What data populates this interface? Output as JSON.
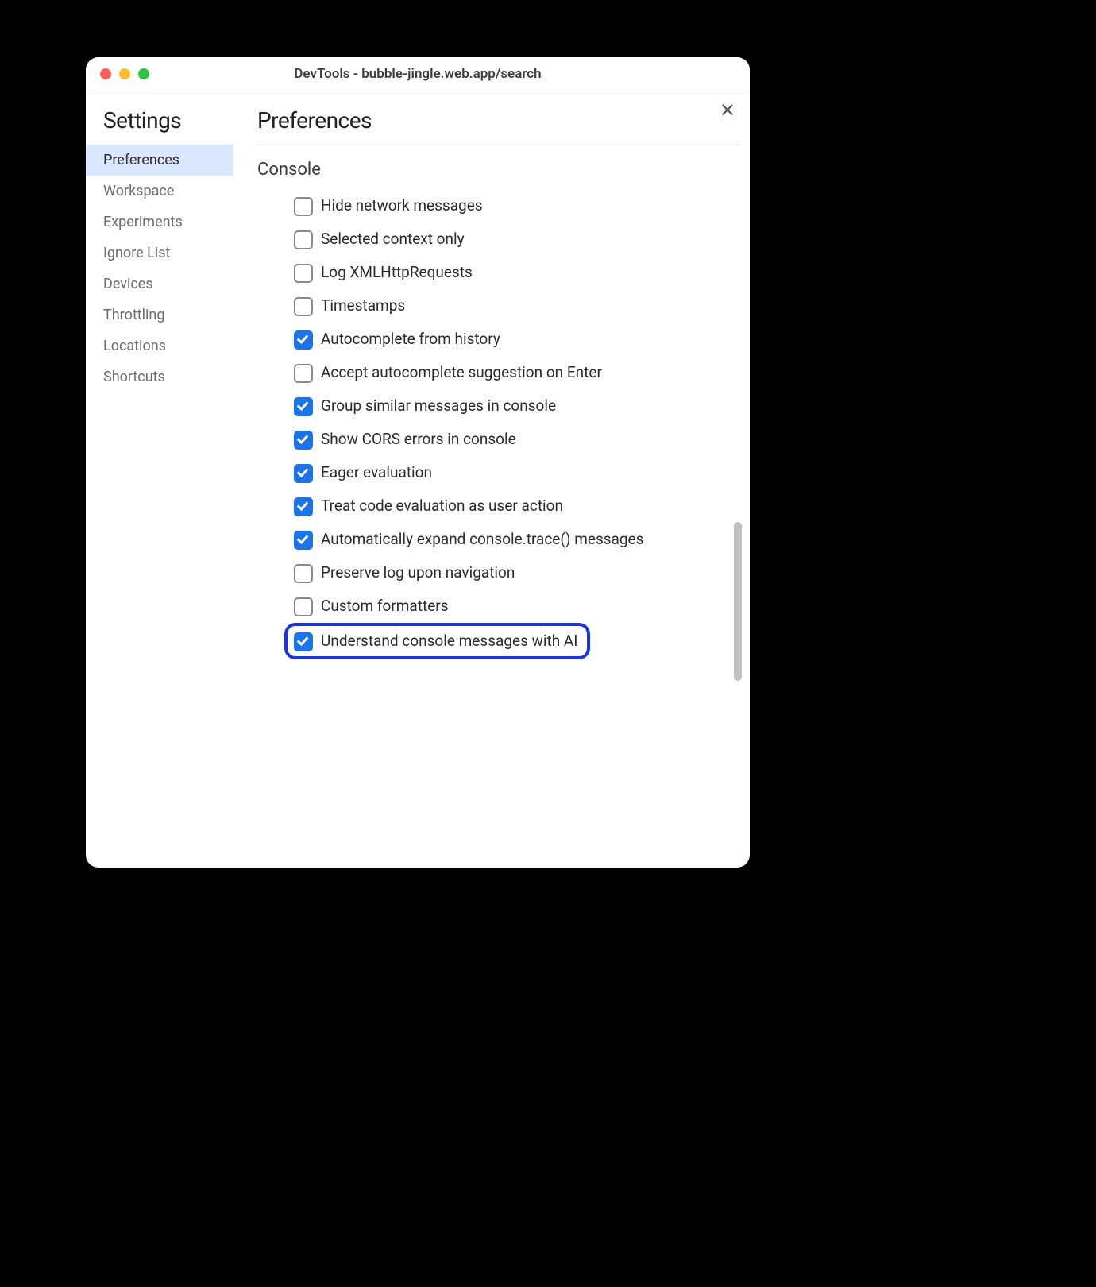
{
  "window": {
    "title": "DevTools - bubble-jingle.web.app/search"
  },
  "sidebar": {
    "title": "Settings",
    "items": [
      {
        "label": "Preferences",
        "active": true
      },
      {
        "label": "Workspace",
        "active": false
      },
      {
        "label": "Experiments",
        "active": false
      },
      {
        "label": "Ignore List",
        "active": false
      },
      {
        "label": "Devices",
        "active": false
      },
      {
        "label": "Throttling",
        "active": false
      },
      {
        "label": "Locations",
        "active": false
      },
      {
        "label": "Shortcuts",
        "active": false
      }
    ]
  },
  "main": {
    "title": "Preferences",
    "section": "Console",
    "options": [
      {
        "label": "Hide network messages",
        "checked": false,
        "highlight": false
      },
      {
        "label": "Selected context only",
        "checked": false,
        "highlight": false
      },
      {
        "label": "Log XMLHttpRequests",
        "checked": false,
        "highlight": false
      },
      {
        "label": "Timestamps",
        "checked": false,
        "highlight": false
      },
      {
        "label": "Autocomplete from history",
        "checked": true,
        "highlight": false
      },
      {
        "label": "Accept autocomplete suggestion on Enter",
        "checked": false,
        "highlight": false
      },
      {
        "label": "Group similar messages in console",
        "checked": true,
        "highlight": false
      },
      {
        "label": "Show CORS errors in console",
        "checked": true,
        "highlight": false
      },
      {
        "label": "Eager evaluation",
        "checked": true,
        "highlight": false
      },
      {
        "label": "Treat code evaluation as user action",
        "checked": true,
        "highlight": false
      },
      {
        "label": "Automatically expand console.trace() messages",
        "checked": true,
        "highlight": false
      },
      {
        "label": "Preserve log upon navigation",
        "checked": false,
        "highlight": false
      },
      {
        "label": "Custom formatters",
        "checked": false,
        "highlight": false
      },
      {
        "label": "Understand console messages with AI",
        "checked": true,
        "highlight": true
      }
    ]
  }
}
